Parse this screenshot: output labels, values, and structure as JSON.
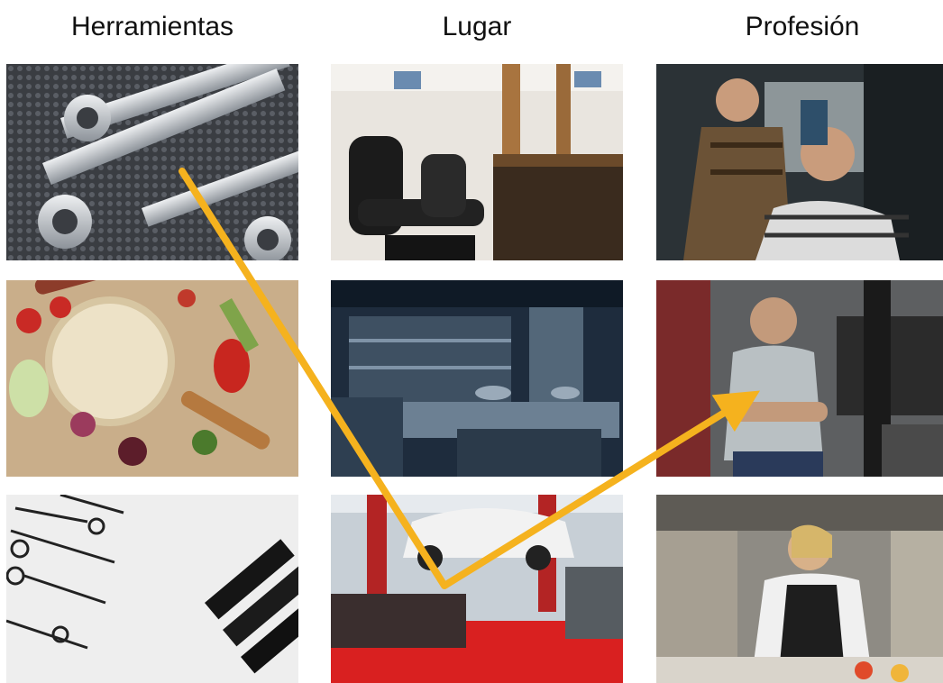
{
  "headers": {
    "tools": "Herramientas",
    "place": "Lugar",
    "profession": "Profesión"
  },
  "images": [
    {
      "id": "wrenches",
      "alt": "wrenches"
    },
    {
      "id": "barbershop",
      "alt": "barbershop"
    },
    {
      "id": "barber",
      "alt": "barber"
    },
    {
      "id": "pan-vegetables",
      "alt": "pan-vegetables"
    },
    {
      "id": "kitchen",
      "alt": "kitchen"
    },
    {
      "id": "mechanic",
      "alt": "mechanic"
    },
    {
      "id": "scissors-combs",
      "alt": "scissors-combs"
    },
    {
      "id": "garage",
      "alt": "garage"
    },
    {
      "id": "chef",
      "alt": "chef"
    }
  ],
  "colors": {
    "arrow": "#f5b21e"
  }
}
